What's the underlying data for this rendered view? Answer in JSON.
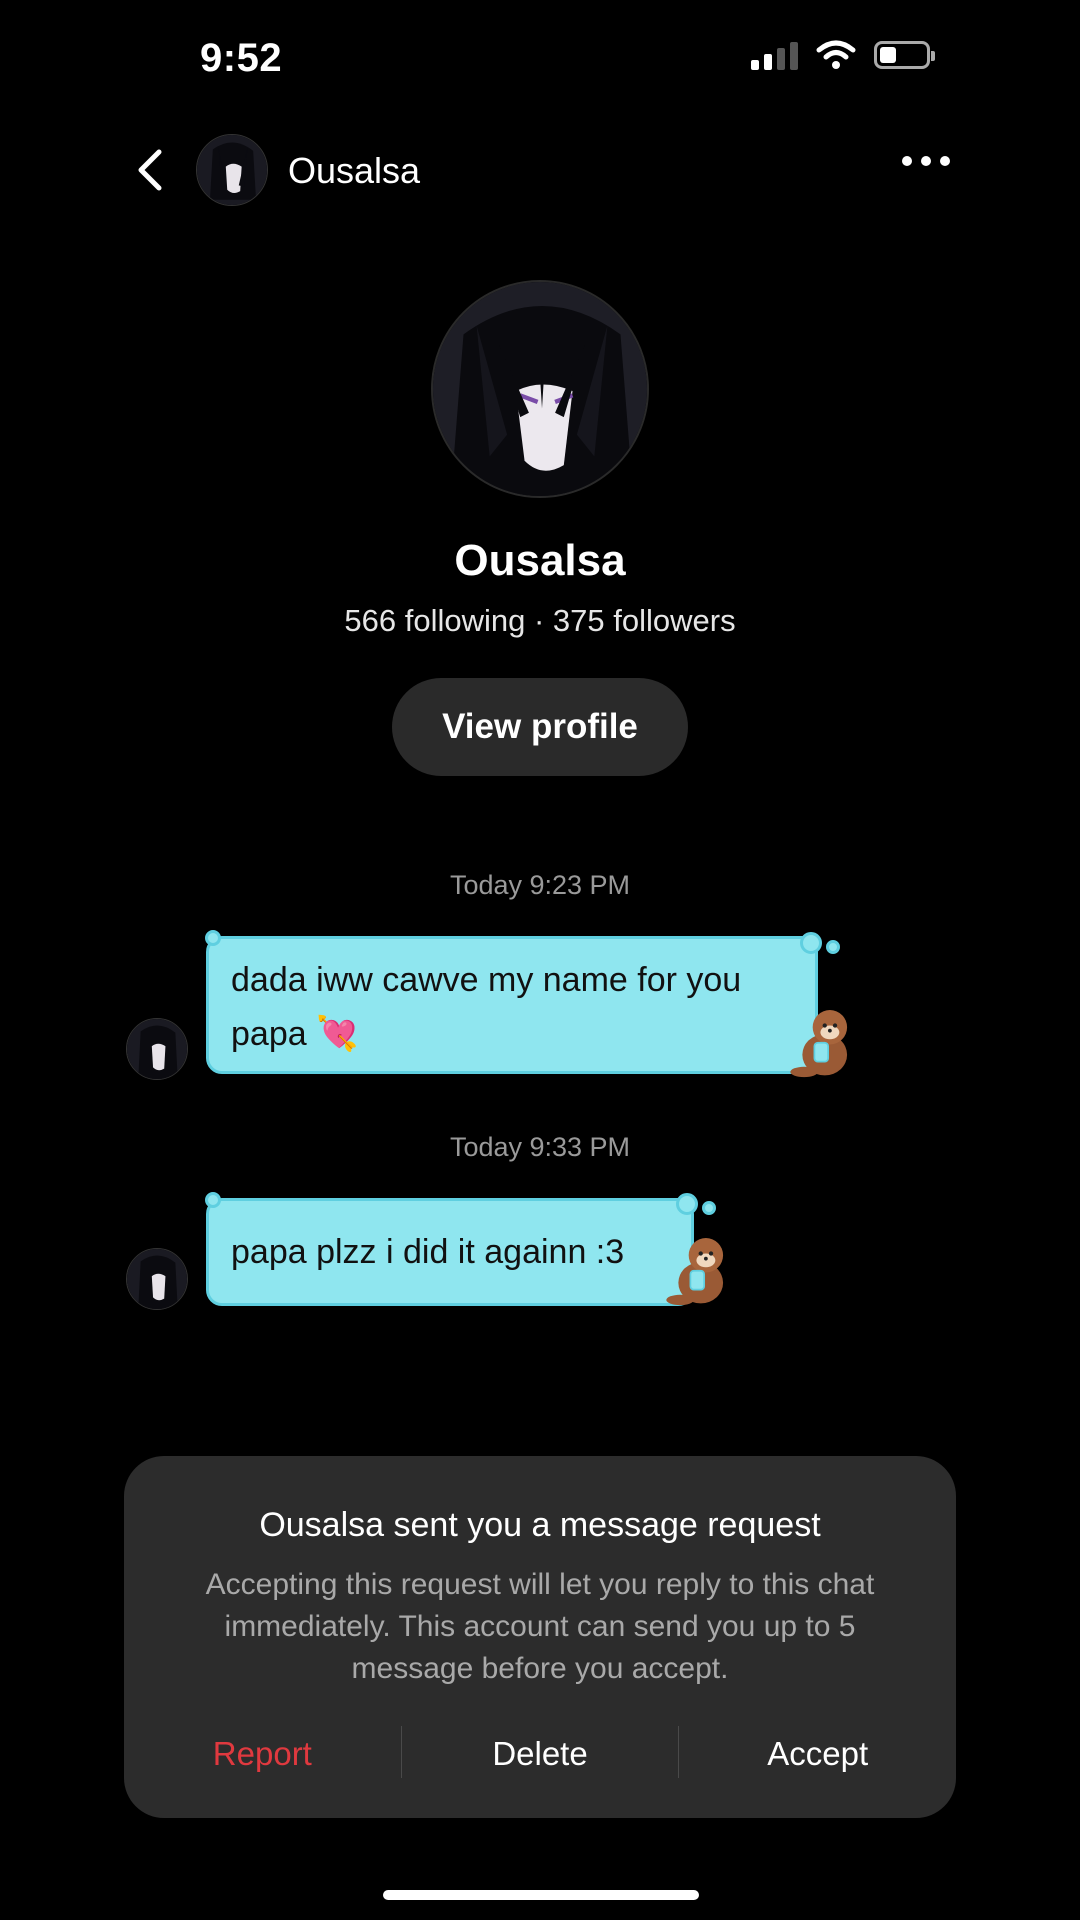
{
  "status_bar": {
    "time": "9:52"
  },
  "header": {
    "name": "Ousalsa"
  },
  "profile": {
    "name": "Ousalsa",
    "stats": "566 following · 375 followers",
    "view_profile_label": "View profile"
  },
  "messages": [
    {
      "timestamp": "Today 9:23 PM",
      "text_line1": "dada iww cawve my name for you",
      "text_line2": "papa 💘"
    },
    {
      "timestamp": "Today 9:33 PM",
      "text": "papa plzz i did it againn :3"
    }
  ],
  "request": {
    "title": "Ousalsa sent you a message request",
    "body": "Accepting this request will let you reply to this chat immediately. This account can send you up to 5 message before you accept.",
    "report_label": "Report",
    "delete_label": "Delete",
    "accept_label": "Accept",
    "report_color": "#e0393f"
  },
  "colors": {
    "bubble": "#8fe6ef",
    "card": "#2c2c2c"
  }
}
